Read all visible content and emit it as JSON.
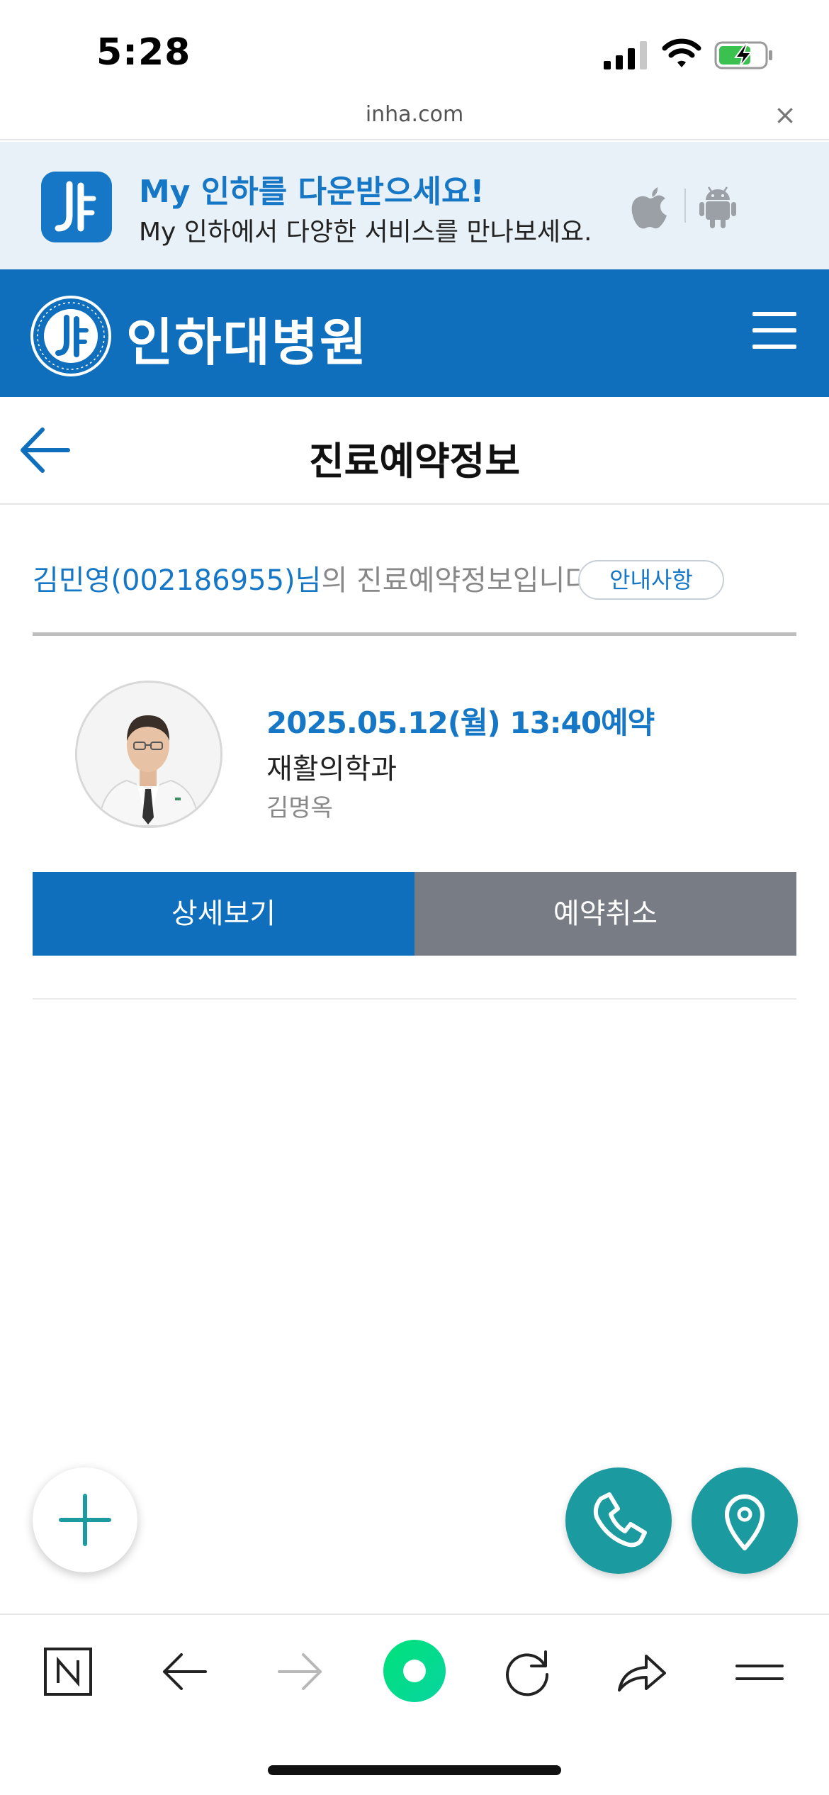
{
  "status_bar": {
    "time": "5:28"
  },
  "url_bar": {
    "url": "inha.com",
    "close_label": "×"
  },
  "app_banner": {
    "title": "My 인하를 다운받으세요!",
    "subtitle": "My 인하에서 다양한 서비스를 만나보세요."
  },
  "header": {
    "logo_text": "인하대병원"
  },
  "page": {
    "title": "진료예약정보"
  },
  "info": {
    "name_id": "김민영(002186955)님",
    "rest": "의 진료예약정보입니다.",
    "notice_button": "안내사항"
  },
  "appointment": {
    "datetime": "2025.05.12(월) 13:40예약",
    "department": "재활의학과",
    "doctor": "김명옥"
  },
  "buttons": {
    "detail": "상세보기",
    "cancel": "예약취소"
  },
  "colors": {
    "brand_blue": "#0f6fbd",
    "link_blue": "#1577c5",
    "cancel_gray": "#787c84",
    "fab_teal": "#1b9ba0",
    "banner_bg": "#e9f1f8"
  },
  "icons": {
    "status": [
      "signal-icon",
      "wifi-icon",
      "battery-charging-icon"
    ],
    "banner": [
      "app-logo-icon",
      "apple-icon",
      "android-icon"
    ],
    "header": [
      "hospital-emblem-icon",
      "hamburger-menu-icon"
    ],
    "fab": [
      "plus-icon",
      "phone-icon",
      "map-pin-icon"
    ],
    "toolbar": [
      "naver-n-icon",
      "back-icon",
      "forward-icon",
      "green-dot-icon",
      "reload-icon",
      "share-icon",
      "menu-lines-icon"
    ]
  }
}
